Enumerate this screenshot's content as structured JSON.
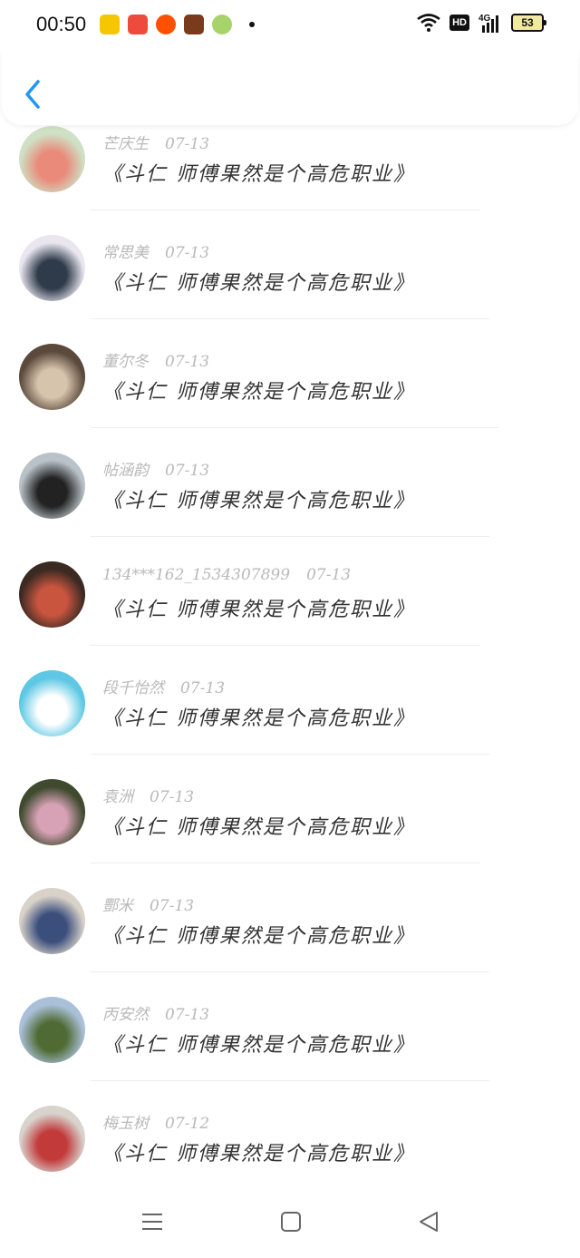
{
  "status_bar": {
    "time": "00:50",
    "network": "4G",
    "hd_label": "HD",
    "battery": "53",
    "app_icons": [
      "app-7-icon",
      "app-pdd-icon",
      "app-taobao-icon",
      "app-game-icon",
      "app-phone-manager-icon"
    ]
  },
  "header": {
    "back_icon": "chevron-left-icon",
    "accent": "#2196f3"
  },
  "comments": [
    {
      "name": "芒庆生",
      "date": "07-13",
      "text": "《斗仁 师傅果然是个高危职业》",
      "avatar_colors": [
        "#cfe0c4",
        "#e98a7a"
      ]
    },
    {
      "name": "常思美",
      "date": "07-13",
      "text": "《斗仁 师傅果然是个高危职业》",
      "avatar_colors": [
        "#e9e6ef",
        "#2f3b4a"
      ]
    },
    {
      "name": "董尔冬",
      "date": "07-13",
      "text": "《斗仁 师傅果然是个高危职业》",
      "avatar_colors": [
        "#5b4a3c",
        "#d7c4ad"
      ]
    },
    {
      "name": "帖涵韵",
      "date": "07-13",
      "text": "《斗仁 师傅果然是个高危职业》",
      "avatar_colors": [
        "#b9c2c8",
        "#222"
      ]
    },
    {
      "name": "134***162_1534307899",
      "date": "07-13",
      "text": "《斗仁 师傅果然是个高危职业》",
      "avatar_colors": [
        "#3a2a22",
        "#c9553f"
      ]
    },
    {
      "name": "段千怡然",
      "date": "07-13",
      "text": "《斗仁 师傅果然是个高危职业》",
      "avatar_colors": [
        "#5ec8e4",
        "#ffffff"
      ]
    },
    {
      "name": "袁洲",
      "date": "07-13",
      "text": "《斗仁 师傅果然是个高危职业》",
      "avatar_colors": [
        "#3f4a2f",
        "#d8a2b6"
      ]
    },
    {
      "name": "酆米",
      "date": "07-13",
      "text": "《斗仁 师傅果然是个高危职业》",
      "avatar_colors": [
        "#d9d2c9",
        "#3b4f7d"
      ]
    },
    {
      "name": "丙安然",
      "date": "07-13",
      "text": "《斗仁 师傅果然是个高危职业》",
      "avatar_colors": [
        "#aac0d9",
        "#4f6a32"
      ]
    },
    {
      "name": "梅玉树",
      "date": "07-12",
      "text": "《斗仁 师傅果然是个高危职业》",
      "avatar_colors": [
        "#d8d3cd",
        "#c23a3a"
      ]
    }
  ],
  "nav_bar": {
    "menu_icon": "menu-icon",
    "home_icon": "home-square-icon",
    "back_icon": "back-triangle-icon"
  }
}
